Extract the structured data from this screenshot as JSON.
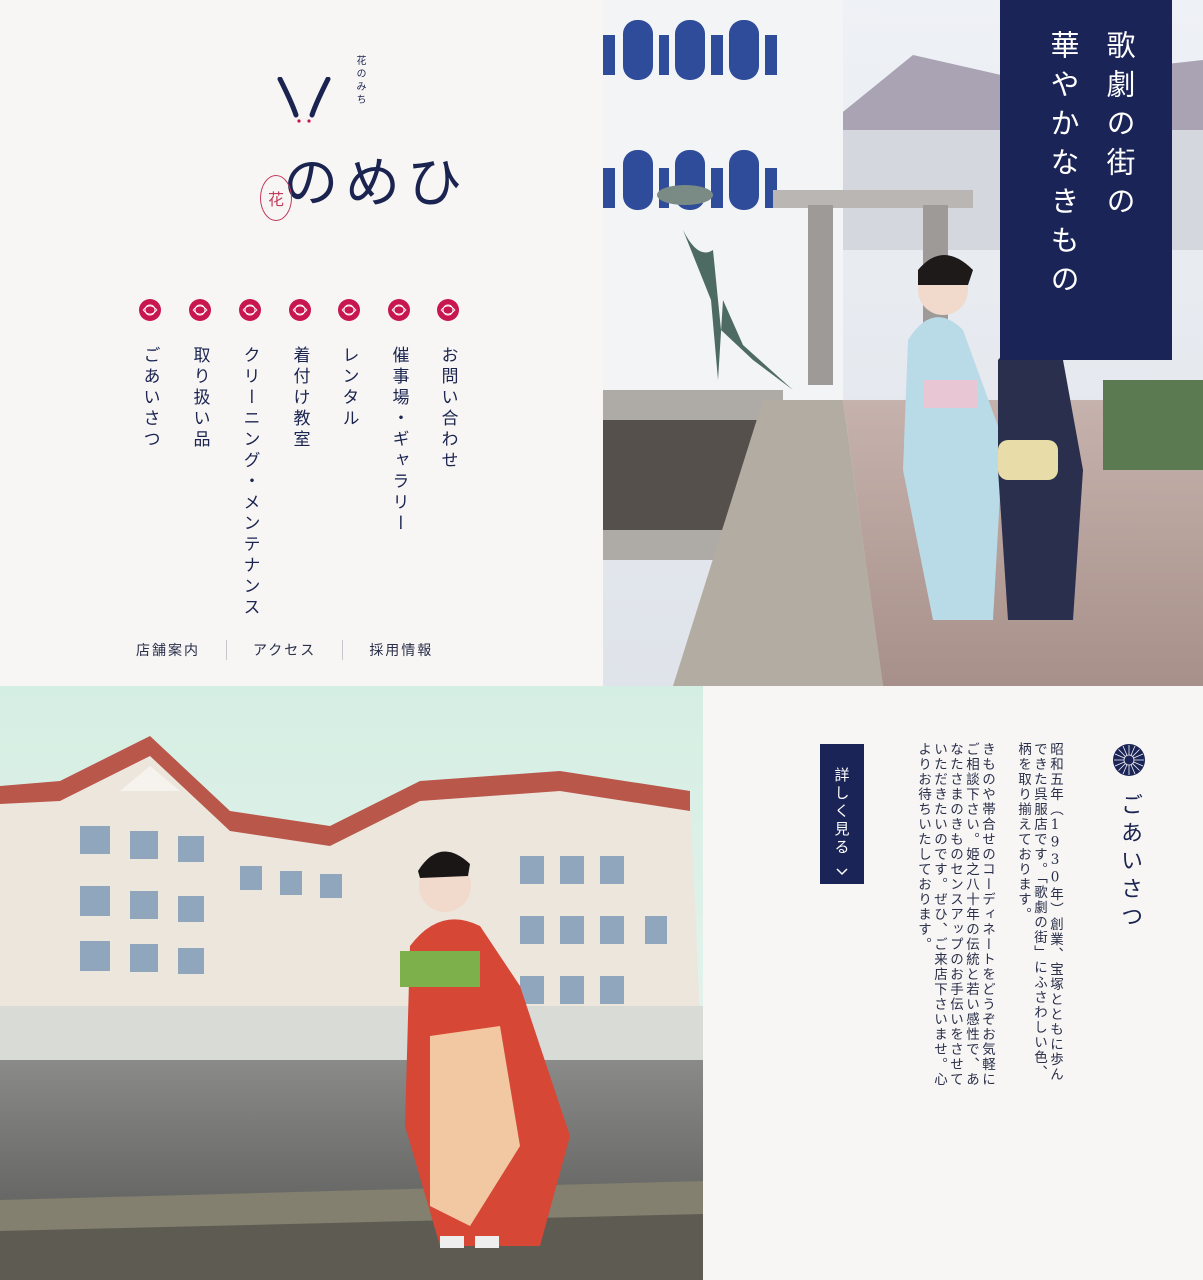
{
  "logo": {
    "small_text": "花のみち",
    "name": "ひめの",
    "seal_text": "花"
  },
  "nav": [
    {
      "label": "お問い合わせ"
    },
    {
      "label": "催事場・ギャラリー"
    },
    {
      "label": "レンタル"
    },
    {
      "label": "着付け教室"
    },
    {
      "label": "クリーニング・メンテナンス"
    },
    {
      "label": "取り扱い品"
    },
    {
      "label": "ごあいさつ"
    }
  ],
  "footer_links": [
    "店舗案内",
    "アクセス",
    "採用情報"
  ],
  "tagline": [
    "歌劇の街の",
    "華やかなきもの"
  ],
  "greeting": {
    "title": "ごあいさつ",
    "more_button": "詳しく見る",
    "paragraphs": [
      "昭和五年（1930年）創業、宝塚とともに歩んできた呉服店です。「歌劇の街」にふさわしい色、柄を取り揃えております。",
      "きものや帯合せのコーディネートをどうぞお気軽にご相談下さい。姫之八十年の伝統と若い感性で、あなたさまのきものセンスアップのお手伝いをさせていただきたいのです。ぜひ、ご来店下さいませ。心よりお待ちいたしております。"
    ]
  },
  "colors": {
    "navy": "#1b2457",
    "crimson": "#c8174f",
    "background": "#f7f6f4"
  }
}
